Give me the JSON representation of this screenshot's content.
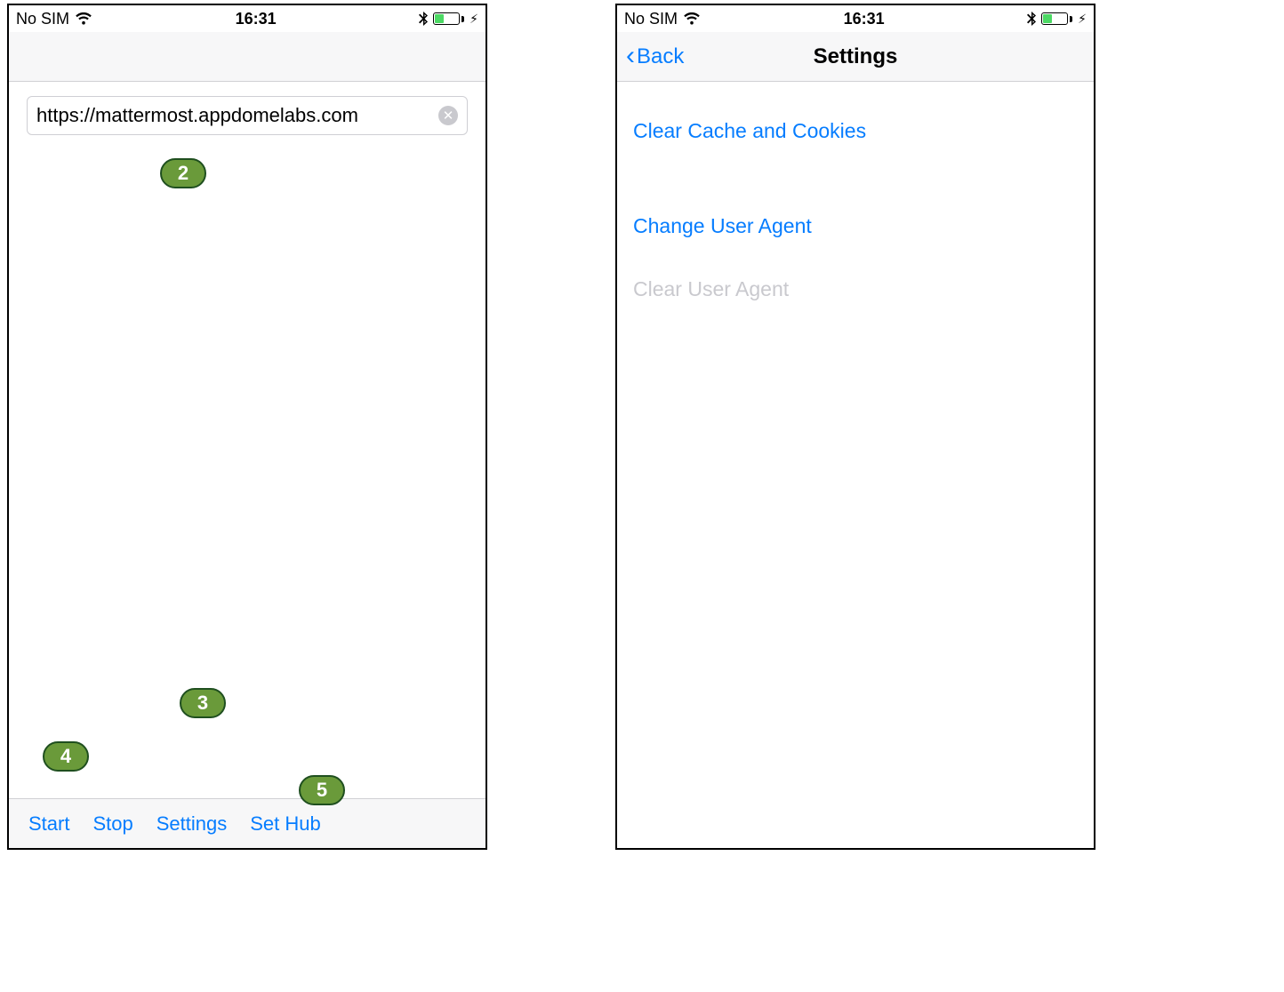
{
  "status": {
    "carrier": "No SIM",
    "time": "16:31"
  },
  "left": {
    "url": "https://mattermost.appdomelabs.com",
    "toolbar": {
      "start": "Start",
      "stop": "Stop",
      "settings": "Settings",
      "sethub": "Set Hub"
    },
    "badges": {
      "a": "2",
      "b": "3",
      "c": "4",
      "d": "5"
    }
  },
  "right": {
    "back": "Back",
    "title": "Settings",
    "items": {
      "clear_cache": "Clear Cache and Cookies",
      "change_ua": "Change User Agent",
      "clear_ua": "Clear User Agent"
    }
  }
}
